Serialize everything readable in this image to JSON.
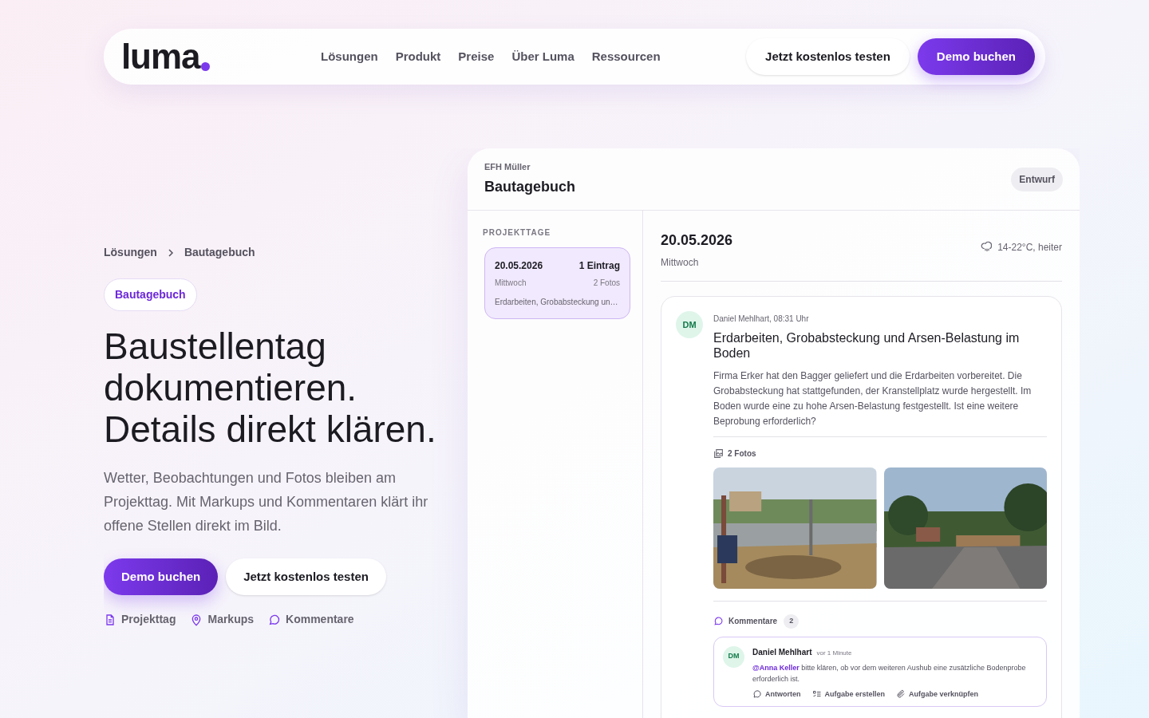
{
  "nav": {
    "logo": "luma",
    "links": [
      "Lösungen",
      "Produkt",
      "Preise",
      "Über Luma",
      "Ressourcen"
    ],
    "secondary_button": "Jetzt kostenlos testen",
    "primary_button": "Demo buchen"
  },
  "hero": {
    "breadcrumb": [
      "Lösungen",
      "Bautagebuch"
    ],
    "tag": "Bautagebuch",
    "heading": "Baustellentag dokumentieren. Details direkt klären.",
    "lead": "Wetter, Beobachtungen und Fotos bleiben am Projekttag. Mit Markups und Kommentaren klärt ihr offene Stellen direkt im Bild.",
    "primary_button": "Demo buchen",
    "secondary_button": "Jetzt kostenlos testen",
    "features": [
      {
        "kind": "document",
        "label": "Projekttag"
      },
      {
        "kind": "pin",
        "label": "Markups"
      },
      {
        "kind": "chat",
        "label": "Kommentare"
      }
    ]
  },
  "app": {
    "project": "EFH Müller",
    "title": "Bautagebuch",
    "status": "Entwurf",
    "sidebar_heading": "PROJEKTTAGE",
    "days": [
      {
        "date": "20.05.2026",
        "entries": "1 Eintrag",
        "weekday": "Mittwoch",
        "photos": "2 Fotos",
        "summary": "Erdarbeiten, Grobabsteckung un…",
        "selected": true
      }
    ],
    "day": {
      "date": "20.05.2026",
      "weekday": "Mittwoch",
      "weather": "14-22°C, heiter"
    },
    "entry": {
      "initials": "DM",
      "author": "Daniel Mehlhart, 08:31 Uhr",
      "title": "Erdarbeiten, Grobabsteckung und Arsen-Belastung im Boden",
      "body": "Firma Erker hat den Bagger geliefert und die Erdarbeiten vorbereitet. Die Grobabsteckung hat stattgefunden, der Kranstellplatz wurde hergestellt. Im Boden wurde eine zu hohe Arsen-Belastung festgestellt. Ist eine weitere Beprobung erforderlich?",
      "photos_label": "2 Fotos",
      "comments_label": "Kommentare",
      "comments_count": "2",
      "comments": [
        {
          "initials": "DM",
          "author": "Daniel Mehlhart",
          "time": "vor 1 Minute",
          "mention": "@Anna Keller",
          "text": "bitte klären, ob vor dem weiteren Aushub eine zusätzliche Bodenprobe erforderlich ist.",
          "actions": [
            {
              "kind": "reply",
              "label": "Antworten"
            },
            {
              "kind": "task",
              "label": "Aufgabe erstellen"
            },
            {
              "kind": "link",
              "label": "Aufgabe verknüpfen"
            }
          ]
        }
      ]
    }
  }
}
